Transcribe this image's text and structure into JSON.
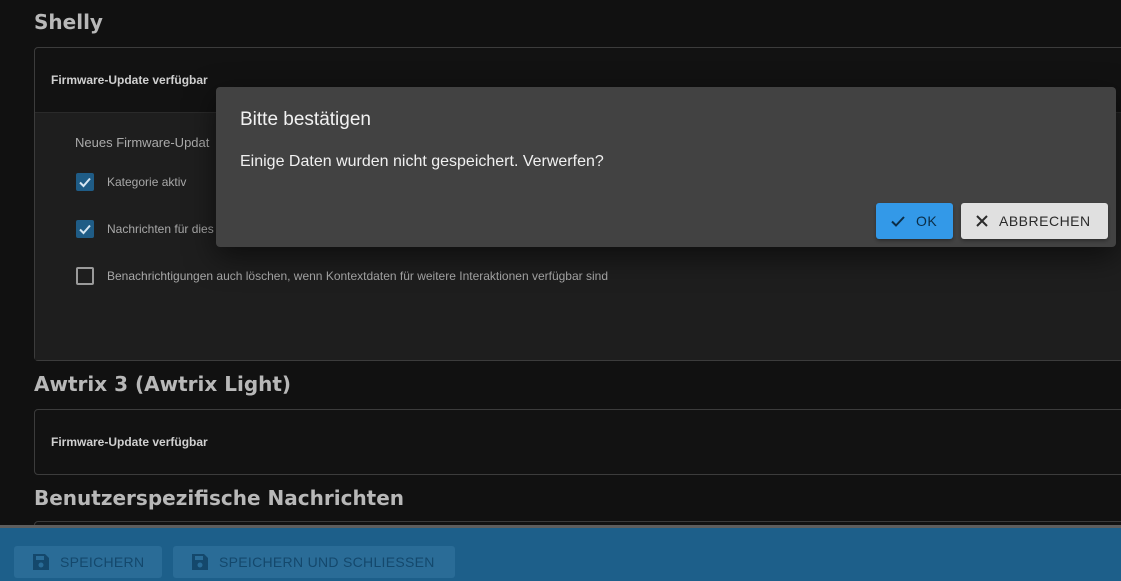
{
  "sections": {
    "shelly": {
      "title": "Shelly",
      "panel_header": "Firmware-Update verfügbar",
      "subtitle": "Neues Firmware-Updat",
      "options": [
        {
          "label": "Kategorie aktiv",
          "checked": true
        },
        {
          "label": "Nachrichten für dies",
          "checked": true
        },
        {
          "label": "Benachrichtigungen auch löschen, wenn Kontextdaten für weitere Interaktionen verfügbar sind",
          "checked": false
        }
      ]
    },
    "awtrix": {
      "title": "Awtrix 3 (Awtrix Light)",
      "panel_header": "Firmware-Update verfügbar"
    },
    "custom": {
      "title": "Benutzerspezifische Nachrichten"
    }
  },
  "dialog": {
    "title": "Bitte bestätigen",
    "message": "Einige Daten wurden nicht gespeichert. Verwerfen?",
    "ok_label": "OK",
    "cancel_label": "ABBRECHEN"
  },
  "bottom_bar": {
    "save_label": "SPEICHERN",
    "save_close_label": "SPEICHERN UND SCHLIESSEN"
  },
  "colors": {
    "accent": "#3399e8",
    "checkbox_checked": "#1f5c86",
    "bottom_bar": "#1d5f8a"
  }
}
